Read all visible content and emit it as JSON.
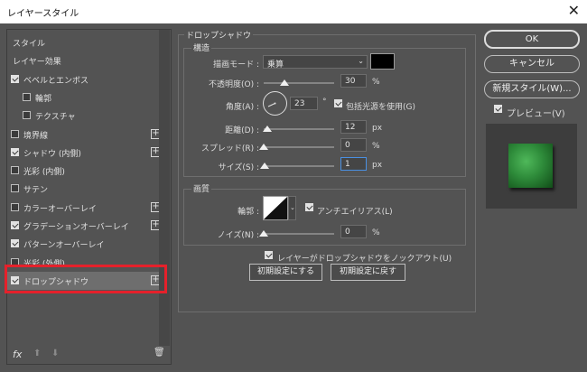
{
  "window": {
    "title": "レイヤースタイル",
    "close": "✕"
  },
  "left_panel": {
    "items": [
      {
        "label": "スタイル",
        "check": "none",
        "plus": false,
        "indent": 0
      },
      {
        "label": "レイヤー効果",
        "check": "none",
        "plus": false,
        "indent": 0
      },
      {
        "label": "ベベルとエンボス",
        "check": "on",
        "plus": false,
        "indent": 0
      },
      {
        "label": "輪郭",
        "check": "off",
        "plus": false,
        "indent": 1
      },
      {
        "label": "テクスチャ",
        "check": "off",
        "plus": false,
        "indent": 1
      },
      {
        "label": "境界線",
        "check": "off",
        "plus": true,
        "indent": 0
      },
      {
        "label": "シャドウ (内側)",
        "check": "on",
        "plus": true,
        "indent": 0
      },
      {
        "label": "光彩 (内側)",
        "check": "off",
        "plus": false,
        "indent": 0
      },
      {
        "label": "サテン",
        "check": "off",
        "plus": false,
        "indent": 0
      },
      {
        "label": "カラーオーバーレイ",
        "check": "off",
        "plus": true,
        "indent": 0
      },
      {
        "label": "グラデーションオーバーレイ",
        "check": "on",
        "plus": true,
        "indent": 0
      },
      {
        "label": "パターンオーバーレイ",
        "check": "on",
        "plus": false,
        "indent": 0
      },
      {
        "label": "光彩 (外側)",
        "check": "off",
        "plus": false,
        "indent": 0
      },
      {
        "label": "ドロップシャドウ",
        "check": "on",
        "plus": true,
        "indent": 0,
        "selected": true
      }
    ],
    "footer": {
      "fx": "fx",
      "up": "⬆",
      "down": "⬇",
      "trash": "🗑"
    }
  },
  "drop_shadow": {
    "title": "ドロップシャドウ",
    "structure": {
      "title": "構造",
      "blend_mode_label": "描画モード :",
      "blend_mode_value": "乗算",
      "color_hex": "#000000",
      "opacity_label": "不透明度(O) :",
      "opacity_value": "30",
      "opacity_unit": "%",
      "opacity_level": 0.3,
      "angle_label": "角度(A) :",
      "angle_value": "23",
      "angle_unit": "°",
      "global_light_label": "包括光源を使用(G)",
      "global_light_checked": true,
      "distance_label": "距離(D) :",
      "distance_value": "12",
      "distance_unit": "px",
      "distance_level": 0.05,
      "spread_label": "スプレッド(R) :",
      "spread_value": "0",
      "spread_unit": "%",
      "spread_level": 0,
      "size_label": "サイズ(S) :",
      "size_value": "1",
      "size_unit": "px",
      "size_level": 0.01
    },
    "quality": {
      "title": "画質",
      "contour_label": "輪郭 :",
      "antialias_label": "アンチエイリアス(L)",
      "antialias_checked": true,
      "noise_label": "ノイズ(N) :",
      "noise_value": "0",
      "noise_unit": "%",
      "noise_level": 0
    },
    "knockout_label": "レイヤーがドロップシャドウをノックアウト(U)",
    "knockout_checked": true,
    "make_default": "初期設定にする",
    "reset_default": "初期設定に戻す"
  },
  "right_panel": {
    "ok": "OK",
    "cancel": "キャンセル",
    "new_style": "新規スタイル(W)...",
    "preview_label": "プレビュー(V)",
    "preview_checked": true,
    "swatch_color": "#2e8b3a"
  }
}
